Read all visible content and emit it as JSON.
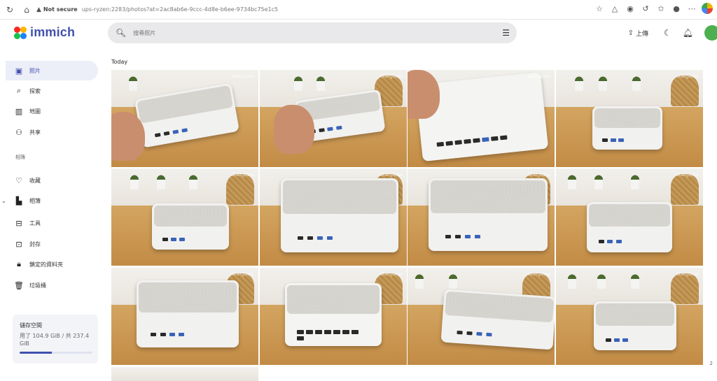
{
  "browser": {
    "security_label": "Not secure",
    "url": "ups-ryzen:2283/photos?at=2ac8ab6e-9ccc-4d8e-b6ee-9734bc75e1c5"
  },
  "app": {
    "name": "immich",
    "brand_color": "#4250af",
    "search_placeholder": "搜尋照片",
    "upload_label": "上傳"
  },
  "sidebar": {
    "items": [
      {
        "label": "照片",
        "icon": "photos-icon",
        "active": true
      },
      {
        "label": "探索",
        "icon": "search-icon"
      },
      {
        "label": "地圖",
        "icon": "map-icon"
      },
      {
        "label": "共享",
        "icon": "share-icon"
      }
    ],
    "library_heading": "相簿",
    "library_items": [
      {
        "label": "收藏",
        "icon": "heart-icon"
      },
      {
        "label": "相簿",
        "icon": "album-icon"
      },
      {
        "label": "工具",
        "icon": "toolbox-icon"
      },
      {
        "label": "封存",
        "icon": "archive-icon"
      },
      {
        "label": "鎖定的資料夾",
        "icon": "lock-icon"
      },
      {
        "label": "垃圾桶",
        "icon": "trash-icon"
      }
    ],
    "storage": {
      "title": "儲存空間",
      "used_text": "用了 104.9 GiB / 共 237.4 GiB",
      "used_fraction": 0.44
    }
  },
  "main": {
    "section_title": "Today",
    "watermark": "Ubergizmo",
    "scroll_marker": "2"
  }
}
